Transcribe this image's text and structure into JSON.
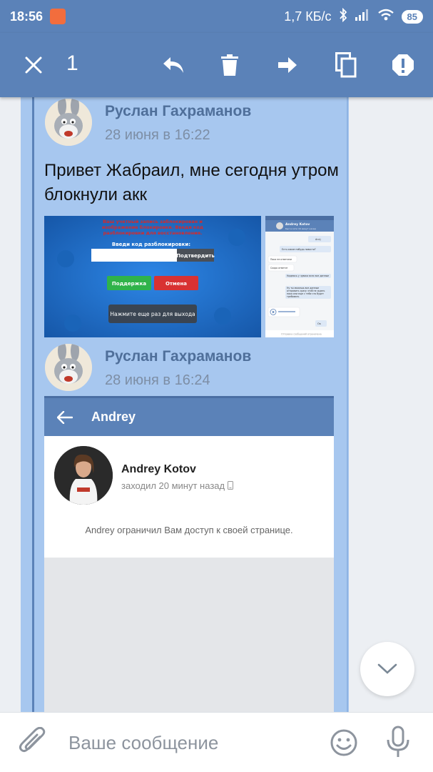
{
  "status_bar": {
    "time": "18:56",
    "network_speed": "1,7 КБ/с",
    "battery": "85"
  },
  "action_bar": {
    "selected_count": "1",
    "icons": [
      "close-icon",
      "reply-icon",
      "delete-icon",
      "forward-icon",
      "copy-icon",
      "report-icon"
    ]
  },
  "messages": [
    {
      "author": "Руслан Гахраманов",
      "date": "28 июня в 16:22",
      "text": "Привет Жабраил, мне сегодня утром блокнули акк",
      "attachments": {
        "game_screen": {
          "banner": "Ваш учетный запись заблокирован и изображение блокировки. Введи код разблокировки для восстановления.",
          "code_label": "Введи код разблокировки:",
          "confirm": "Подтвердить",
          "support": "Поддержка",
          "cancel": "Отмена",
          "exit_hint": "Нажмите еще раз для выхода"
        },
        "chat_screen": {
          "contact": "Andrey Kotov",
          "status": "был в сети 16 минут назад",
          "bubbles": [
            "Ага)",
            "Есть какие нибудь новости?",
            "Пока не ответили",
            "Скоро ответят",
            "Надеюсь у чувака всех все данные",
            "Ну ты можешь все данные отправить сразу чтоб не ждать пока они еще с тебя что будет требовать",
            "Ок"
          ],
          "restricted": "Отправка сообщений ограничена"
        }
      }
    },
    {
      "author": "Руслан Гахраманов",
      "date": "28 июня в 16:24",
      "attachments": {
        "profile_screen": {
          "header_title": "Andrey",
          "name": "Andrey Kotov",
          "last_seen": "заходил 20 минут назад",
          "notice": "Andrey ограничил Вам доступ к своей странице."
        }
      }
    }
  ],
  "input_bar": {
    "placeholder": "Ваше сообщение"
  },
  "colors": {
    "brand": "#5b82b8",
    "selection": "#a7c7ef",
    "chat_bg": "#eceff3"
  }
}
